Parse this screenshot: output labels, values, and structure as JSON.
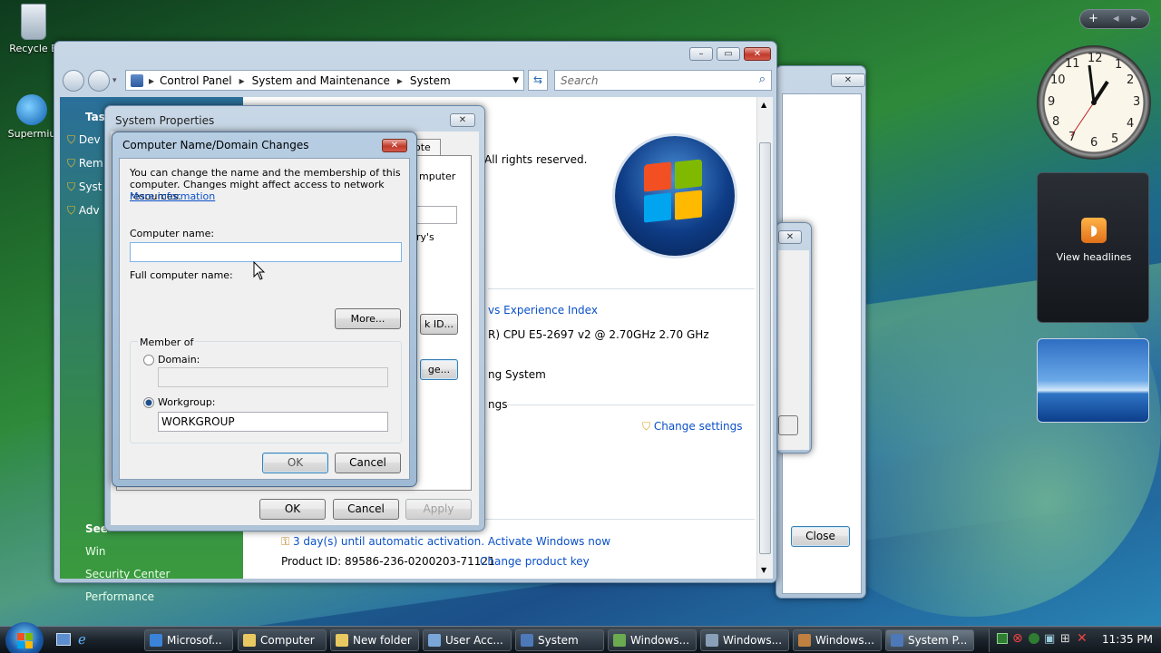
{
  "desktop": {
    "icons": [
      {
        "label": "Recycle B"
      },
      {
        "label": "Supermiu"
      }
    ]
  },
  "explorer": {
    "breadcrumb": [
      "Control Panel",
      "System and Maintenance",
      "System"
    ],
    "search_placeholder": "Search",
    "sidebar": {
      "tasks_heading": "Tas",
      "tasks": [
        "Dev",
        "Rem",
        "Syst",
        "Adv"
      ],
      "see_also_heading": "See",
      "see_also": [
        "Win",
        "Security Center",
        "Performance"
      ]
    },
    "content": {
      "rights": "All rights reserved.",
      "wei_link": "vs Experience Index",
      "processor": "R) CPU E5-2697 v2 @ 2.70GHz   2.70 GHz",
      "os_type": "ng System",
      "settings_heading": "ngs",
      "change_settings": "Change settings",
      "activation": "3 day(s) until automatic activation. Activate Windows now",
      "product_id": "Product ID: 89586-236-0200203-71121",
      "change_key": "Change product key"
    }
  },
  "back_dialog": {
    "close_label": "Close"
  },
  "system_properties": {
    "title": "System Properties",
    "tab_fragment": "ote",
    "frag_computer": "mputer",
    "frag_ys": "ry's",
    "frag_id_button": "k ID...",
    "frag_change_button": "ge...",
    "ok": "OK",
    "cancel": "Cancel",
    "apply": "Apply"
  },
  "name_dialog": {
    "title": "Computer Name/Domain Changes",
    "intro": "You can change the name and the membership of this computer. Changes might affect access to network resources.",
    "more_info": "More information",
    "computer_name_label": "Computer name:",
    "computer_name_value": "",
    "full_name_label": "Full computer name:",
    "more_button": "More...",
    "member_of": "Member of",
    "domain_label": "Domain:",
    "domain_value": "",
    "workgroup_label": "Workgroup:",
    "workgroup_value": "WORKGROUP",
    "ok": "OK",
    "cancel": "Cancel"
  },
  "gadgets": {
    "feed_label": "View headlines",
    "clock_numbers": [
      "12",
      "1",
      "2",
      "3",
      "4",
      "5",
      "6",
      "7",
      "8",
      "9",
      "10",
      "11"
    ]
  },
  "taskbar": {
    "items": [
      "Microsof...",
      "Computer",
      "New folder",
      "User Acc...",
      "System",
      "Windows...",
      "Windows...",
      "Windows...",
      "System P..."
    ],
    "time": "11:35 PM"
  },
  "colors": {
    "link": "#0a50c8",
    "sidebar_green": "#2f8a3c",
    "close_red": "#c0392b"
  }
}
